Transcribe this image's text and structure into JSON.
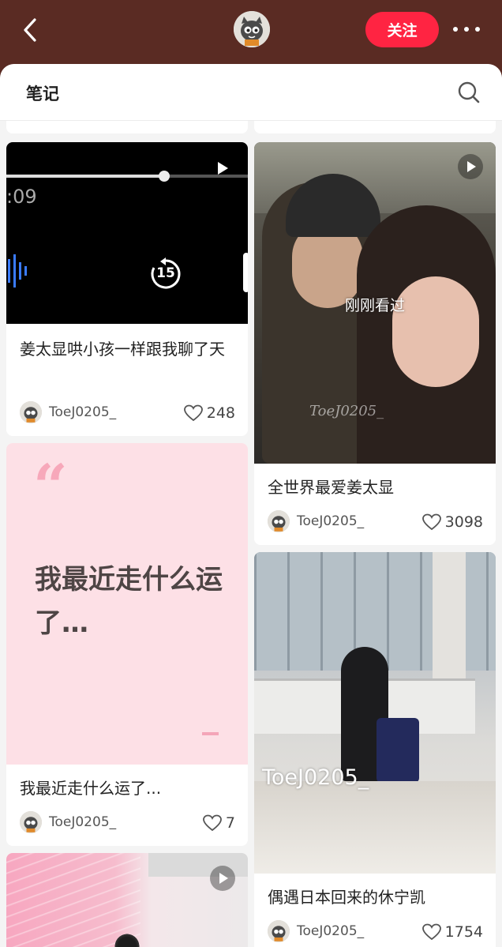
{
  "header": {
    "follow_label": "关注"
  },
  "notes_bar": {
    "title": "笔记"
  },
  "cards": [
    {
      "title": "姜太显哄小孩一样跟我聊了天",
      "author": "ToeJ0205_",
      "likes": "248",
      "cover": {
        "time_text": ":09",
        "rewind_label": "15"
      }
    },
    {
      "title": "全世界最爱姜太显",
      "author": "ToeJ0205_",
      "likes": "3098",
      "cover": {
        "overlay_text": "刚刚看过",
        "watermark": "ToeJ0205_"
      }
    },
    {
      "title": "我最近走什么运了...",
      "author": "ToeJ0205_",
      "likes": "7",
      "cover": {
        "quote_mark": "“",
        "quote_text": "我最近走什么运了…"
      }
    },
    {
      "title": "偶遇日本回来的休宁凯",
      "author": "ToeJ0205_",
      "likes": "1754",
      "cover": {
        "watermark": "ToeJ0205_"
      }
    }
  ],
  "colors": {
    "top_bar": "#5a2b23",
    "accent": "#ff2442",
    "quote_card_bg": "#fde0e6",
    "quote_mark": "#f7a8ba"
  },
  "icons": [
    "back-icon",
    "avatar",
    "more-icon",
    "search-icon",
    "heart-icon",
    "play-icon",
    "rewind-15-icon"
  ]
}
